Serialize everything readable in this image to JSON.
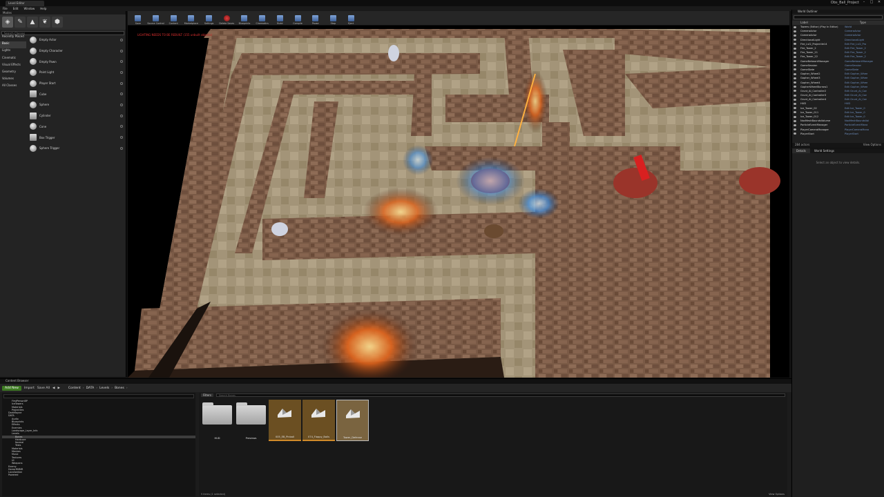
{
  "window": {
    "tab_label": "Level Editor",
    "project": "Obs_Ball_Project",
    "controls": [
      "–",
      "□",
      "✕"
    ]
  },
  "menu": [
    "File",
    "Edit",
    "Window",
    "Help"
  ],
  "modes": {
    "header": "Modes",
    "search_placeholder": "Search Classes",
    "categories": [
      "Recently Placed",
      "Basic",
      "Lights",
      "Cinematic",
      "Visual Effects",
      "Geometry",
      "Volumes",
      "All Classes"
    ],
    "selected_category": "Basic",
    "items": [
      "Empty Actor",
      "Empty Character",
      "Empty Pawn",
      "Point Light",
      "Player Start",
      "Cube",
      "Sphere",
      "Cylinder",
      "Cone",
      "Box Trigger",
      "Sphere Trigger"
    ]
  },
  "toolbar": [
    {
      "label": "Save",
      "icon": "save-icon"
    },
    {
      "label": "Source Control",
      "icon": "source-control-icon"
    },
    {
      "label": "Content",
      "icon": "content-icon"
    },
    {
      "label": "Marketplace",
      "icon": "marketplace-icon"
    },
    {
      "label": "Settings",
      "icon": "settings-icon"
    },
    {
      "label": "Delete Saves",
      "icon": "delete-saves-icon"
    },
    {
      "label": "Blueprints",
      "icon": "blueprints-icon"
    },
    {
      "label": "Cinematics",
      "icon": "cinematics-icon"
    },
    {
      "label": "Build",
      "icon": "build-icon"
    },
    {
      "label": "Compile",
      "icon": "compile-icon"
    },
    {
      "label": "Pause",
      "icon": "pause-icon"
    },
    {
      "label": "Stop",
      "icon": "stop-icon"
    },
    {
      "label": "Eject",
      "icon": "eject-icon"
    }
  ],
  "viewport": {
    "warning": "LIGHTING NEEDS TO BE REBUILT (155 unbuilt objects)"
  },
  "outliner": {
    "tab": "World Outliner",
    "columns": {
      "label": "Label",
      "type": "Type"
    },
    "rows": [
      {
        "name": "Towers (Editor) (Play In Editor)",
        "type": "World"
      },
      {
        "name": "CameraActor",
        "type": "CameraActor"
      },
      {
        "name": "CameraActor",
        "type": "CameraActor"
      },
      {
        "name": "DirectionalLight",
        "type": "DirectionalLight"
      },
      {
        "name": "Fire_Lvl2_Projectile14",
        "type": "Edit Fire_Lvl2_Pro"
      },
      {
        "name": "Fire_Tower_2",
        "type": "Edit Fire_Tower_2"
      },
      {
        "name": "Fire_Tower_21",
        "type": "Edit Fire_Tower_2"
      },
      {
        "name": "Fire_Tower_22",
        "type": "Edit Fire_Tower_2"
      },
      {
        "name": "GameNetworkManager",
        "type": "GameNetworkManager"
      },
      {
        "name": "GameSession",
        "type": "GameSession"
      },
      {
        "name": "GameState",
        "type": "GameState"
      },
      {
        "name": "Gopher_Wheel2",
        "type": "Edit Gopher_Whee"
      },
      {
        "name": "Gopher_Wheel3",
        "type": "Edit Gopher_Whee"
      },
      {
        "name": "Gopher_Wheel4",
        "type": "Edit Gopher_Whee"
      },
      {
        "name": "GopherWheelBurrow1",
        "type": "Edit Gopher_Whee"
      },
      {
        "name": "Grunt_AI_Controller2",
        "type": "Edit Grunt_AI_Con"
      },
      {
        "name": "Grunt_AI_Controller3",
        "type": "Edit Grunt_AI_Con"
      },
      {
        "name": "Grunt_AI_Controller4",
        "type": "Edit Grunt_AI_Con"
      },
      {
        "name": "HUD",
        "type": "HUD"
      },
      {
        "name": "Ice_Tower_02",
        "type": "Edit Ice_Tower_0"
      },
      {
        "name": "Ice_Tower_011",
        "type": "Edit Ice_Tower_0"
      },
      {
        "name": "Ice_Tower_012",
        "type": "Edit Ice_Tower_0"
      },
      {
        "name": "NavMeshBoundsVolume",
        "type": "NavMeshBoundsVol"
      },
      {
        "name": "ParticleEventManager",
        "type": "ParticleEventMana"
      },
      {
        "name": "PlayerCameraManager",
        "type": "PlayerCameraMana"
      },
      {
        "name": "PlayerStart",
        "type": "PlayerStart"
      }
    ],
    "footer_count": "284 actors",
    "view_options": "View Options"
  },
  "details": {
    "tabs": [
      "Details",
      "World Settings"
    ],
    "hint": "Select an object to view details."
  },
  "content_browser": {
    "tab": "Content Browser",
    "add_new": "Add New",
    "import": "Import",
    "save_all": "Save All",
    "breadcrumb": [
      "Content",
      "DATA",
      "Levels",
      "Bones"
    ],
    "tree": [
      "FirstPersonBP",
      "IceTowers",
      "Materials",
      "Projectiles",
      "DarkMayne",
      "DATA",
      "Audio",
      "Blueprints",
      "Effects",
      "Enemies",
      "Landscape_Layer_Info",
      "Levels",
      "Bones",
      "Hardcore",
      "Normal",
      "Tests",
      "Materials",
      "Meshes",
      "Music",
      "Textures",
      "UI",
      "Weapons",
      "Enemy",
      "HorrorRMMR",
      "Localization",
      "Powered"
    ],
    "selected_tree": "Bones",
    "filters_label": "Filters",
    "search_placeholder": "Search Bones",
    "assets": [
      {
        "label": "HUD",
        "kind": "folder"
      },
      {
        "label": "Previews",
        "kind": "folder"
      },
      {
        "label": "005_EB_Pinball",
        "kind": "map"
      },
      {
        "label": "074_Floppy_Balls",
        "kind": "map"
      },
      {
        "label": "Tower_Defense",
        "kind": "map",
        "selected": true
      }
    ],
    "status": "5 items (1 selected)",
    "view_options": "View Options"
  }
}
